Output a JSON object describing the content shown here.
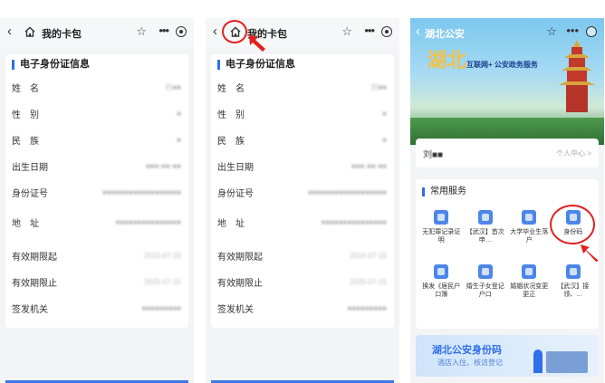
{
  "panel1": {
    "title": "我的卡包",
    "section": "电子身份证信息",
    "rows": [
      {
        "label": "姓　名",
        "value": "刘■■"
      },
      {
        "label": "性　别",
        "value": "■"
      },
      {
        "label": "民　族",
        "value": "■"
      },
      {
        "label": "出生日期",
        "value": "■■■-■■-■■"
      },
      {
        "label": "身份证号",
        "value": "■■■■■■■■■■■■■■■■■■"
      },
      {
        "label": "地　址",
        "value": "■■■■■■■■■■■■■■■"
      },
      {
        "label": "有效期限起",
        "value": "2015-07-15"
      },
      {
        "label": "有效期限止",
        "value": "2025-07-15"
      },
      {
        "label": "签发机关",
        "value": "■■■■■■■■■"
      }
    ]
  },
  "panel2": {
    "title": "我的卡包",
    "section": "电子身份证信息",
    "rows": [
      {
        "label": "姓　名",
        "value": "刘■■"
      },
      {
        "label": "性　别",
        "value": "■"
      },
      {
        "label": "民　族",
        "value": "■"
      },
      {
        "label": "出生日期",
        "value": "■■■-■■-■■"
      },
      {
        "label": "身份证号",
        "value": "■■■■■■■■■■■■■■■■■■"
      },
      {
        "label": "地　址",
        "value": "■■■■■■■■■■■■■■■"
      },
      {
        "label": "有效期限起",
        "value": "2015-07-15"
      },
      {
        "label": "有效期限止",
        "value": "2025-07-15"
      },
      {
        "label": "签发机关",
        "value": "■■■■■■■■■"
      }
    ]
  },
  "panel3": {
    "title": "湖北公安",
    "banner_calligraphy": "湖北",
    "banner_slogan": "互联网+ 公安政务服务",
    "user_name": "刘■■",
    "user_center": "个人中心 >",
    "services_title": "常用服务",
    "services": [
      {
        "label": "无犯罪记录证明",
        "icon": "badge-icon"
      },
      {
        "label": "【武汉】首次申…",
        "icon": "id-card-icon"
      },
      {
        "label": "大学毕业生落户",
        "icon": "person-icon"
      },
      {
        "label": "身份码",
        "icon": "qr-icon"
      },
      {
        "label": "换发《居民户口簿",
        "icon": "book-icon"
      },
      {
        "label": "婚生子女登记户口",
        "icon": "baby-icon"
      },
      {
        "label": "婚姻状况变更更正",
        "icon": "shield-icon"
      },
      {
        "label": "【武汉】接领、…",
        "icon": "id-card-icon"
      }
    ],
    "promo_title": "湖北公安身份码",
    "promo_subtitle": "酒店入住、核访登记"
  },
  "colors": {
    "accent": "#2f6fe8",
    "highlight": "#e02020"
  }
}
